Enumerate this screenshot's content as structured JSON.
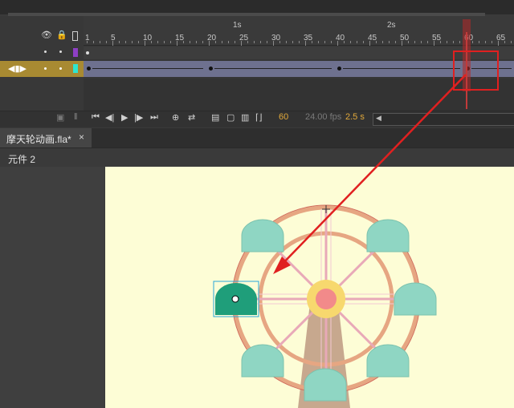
{
  "timeline": {
    "second_labels": [
      "1s",
      "2s"
    ],
    "frame_labels": [
      "1",
      "5",
      "10",
      "15",
      "20",
      "25",
      "30",
      "35",
      "40",
      "45",
      "50",
      "55",
      "60",
      "65"
    ],
    "current_frame_highlight": "60"
  },
  "controls": {
    "current_frame": "60",
    "fps": "24.00 fps",
    "elapsed": "2.5 s"
  },
  "document": {
    "tab_title": "摩天轮动画.fla*",
    "close_glyph": "×"
  },
  "breadcrumb": {
    "item": "元件 2"
  },
  "colors": {
    "stage_bg": "#fdfdd6",
    "layer_row": "#6e718f",
    "layer_selected": "#a88a32",
    "annotation": "#e02020",
    "cabin": "#8fd6c3",
    "cabin_selected": "#1f9e7a",
    "wheel": "#e0a682",
    "hub": "#f6d46e"
  },
  "icons": [
    "eye-icon",
    "lock-icon",
    "outline-icon",
    "play-icon",
    "loop-icon"
  ]
}
